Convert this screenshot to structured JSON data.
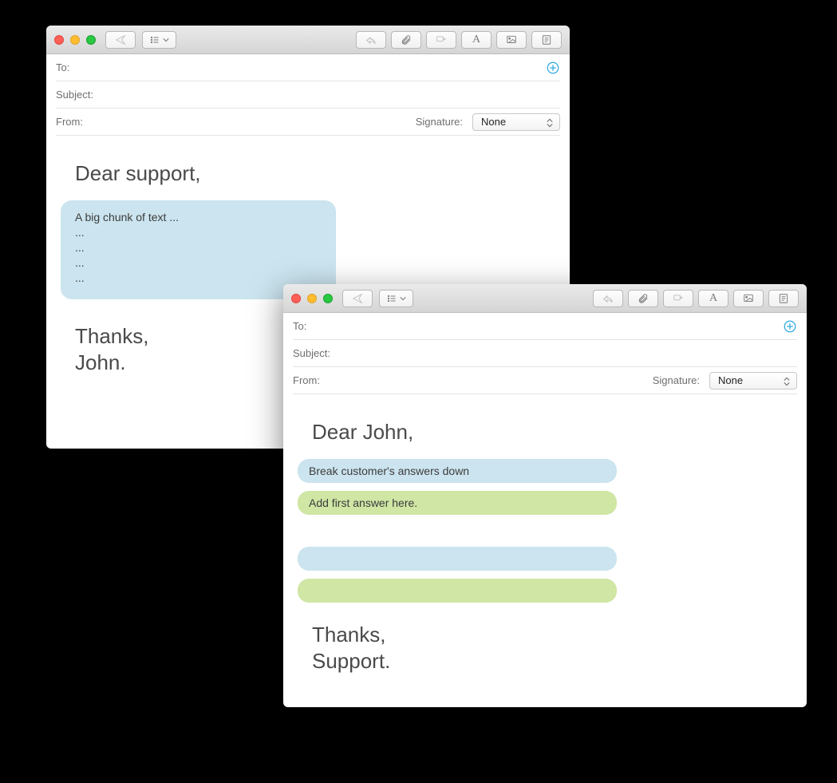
{
  "toolbar_icons": {
    "send": "send-icon",
    "list": "list-icon",
    "reply": "reply-icon",
    "attach": "paperclip-icon",
    "mark": "mark-icon",
    "format": "format-icon",
    "media": "media-icon",
    "notes": "notes-icon"
  },
  "labels": {
    "to": "To:",
    "subject": "Subject:",
    "from": "From:",
    "signature": "Signature:"
  },
  "signature_value": "None",
  "window1": {
    "greeting": "Dear support,",
    "chunk": "A big chunk of text ...\n...\n...\n...\n...",
    "signoff_thanks": "Thanks,",
    "signoff_who": "John."
  },
  "window2": {
    "greeting": "Dear John,",
    "bar_blue_1": "Break customer's answers down",
    "bar_green_1": "Add first answer here.",
    "bar_blue_2": "",
    "bar_green_2": "",
    "signoff_thanks": "Thanks,",
    "signoff_who": "Support."
  }
}
